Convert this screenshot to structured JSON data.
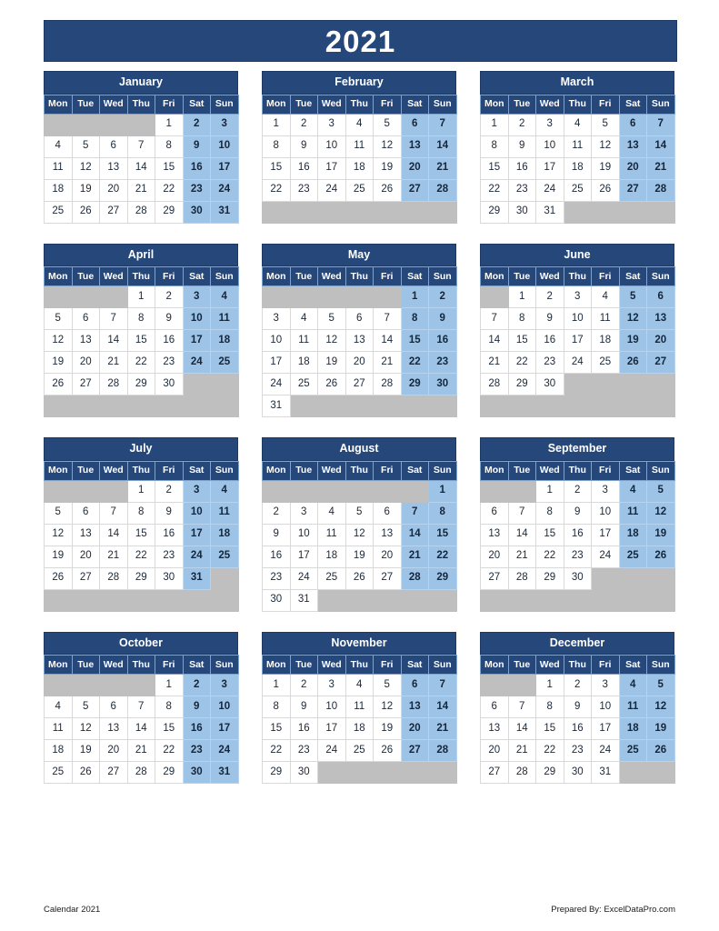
{
  "document": {
    "title": "2021",
    "footer_left": "Calendar 2021",
    "footer_right": "Prepared By: ExcelDataPro.com"
  },
  "colors": {
    "header_blue": "#26477a",
    "weekend_blue": "#9dc3e6",
    "filler_gray": "#bfbfbf",
    "weekday_white": "#ffffff",
    "text_dark": "#1b2838"
  },
  "weekday_headers": [
    "Mon",
    "Tue",
    "Wed",
    "Thu",
    "Fri",
    "Sat",
    "Sun"
  ],
  "months": [
    {
      "name": "January",
      "weeks": [
        [
          "",
          "",
          "",
          "",
          "1",
          "2",
          "3"
        ],
        [
          "4",
          "5",
          "6",
          "7",
          "8",
          "9",
          "10"
        ],
        [
          "11",
          "12",
          "13",
          "14",
          "15",
          "16",
          "17"
        ],
        [
          "18",
          "19",
          "20",
          "21",
          "22",
          "23",
          "24"
        ],
        [
          "25",
          "26",
          "27",
          "28",
          "29",
          "30",
          "31"
        ]
      ]
    },
    {
      "name": "February",
      "weeks": [
        [
          "1",
          "2",
          "3",
          "4",
          "5",
          "6",
          "7"
        ],
        [
          "8",
          "9",
          "10",
          "11",
          "12",
          "13",
          "14"
        ],
        [
          "15",
          "16",
          "17",
          "18",
          "19",
          "20",
          "21"
        ],
        [
          "22",
          "23",
          "24",
          "25",
          "26",
          "27",
          "28"
        ],
        [
          "",
          "",
          "",
          "",
          "",
          "",
          ""
        ]
      ]
    },
    {
      "name": "March",
      "weeks": [
        [
          "1",
          "2",
          "3",
          "4",
          "5",
          "6",
          "7"
        ],
        [
          "8",
          "9",
          "10",
          "11",
          "12",
          "13",
          "14"
        ],
        [
          "15",
          "16",
          "17",
          "18",
          "19",
          "20",
          "21"
        ],
        [
          "22",
          "23",
          "24",
          "25",
          "26",
          "27",
          "28"
        ],
        [
          "29",
          "30",
          "31",
          "",
          "",
          "",
          ""
        ]
      ]
    },
    {
      "name": "April",
      "weeks": [
        [
          "",
          "",
          "",
          "1",
          "2",
          "3",
          "4"
        ],
        [
          "5",
          "6",
          "7",
          "8",
          "9",
          "10",
          "11"
        ],
        [
          "12",
          "13",
          "14",
          "15",
          "16",
          "17",
          "18"
        ],
        [
          "19",
          "20",
          "21",
          "22",
          "23",
          "24",
          "25"
        ],
        [
          "26",
          "27",
          "28",
          "29",
          "30",
          "",
          ""
        ],
        [
          "",
          "",
          "",
          "",
          "",
          "",
          ""
        ]
      ]
    },
    {
      "name": "May",
      "weeks": [
        [
          "",
          "",
          "",
          "",
          "",
          "1",
          "2"
        ],
        [
          "3",
          "4",
          "5",
          "6",
          "7",
          "8",
          "9"
        ],
        [
          "10",
          "11",
          "12",
          "13",
          "14",
          "15",
          "16"
        ],
        [
          "17",
          "18",
          "19",
          "20",
          "21",
          "22",
          "23"
        ],
        [
          "24",
          "25",
          "26",
          "27",
          "28",
          "29",
          "30"
        ],
        [
          "31",
          "",
          "",
          "",
          "",
          "",
          ""
        ]
      ]
    },
    {
      "name": "June",
      "weeks": [
        [
          "",
          "1",
          "2",
          "3",
          "4",
          "5",
          "6"
        ],
        [
          "7",
          "8",
          "9",
          "10",
          "11",
          "12",
          "13"
        ],
        [
          "14",
          "15",
          "16",
          "17",
          "18",
          "19",
          "20"
        ],
        [
          "21",
          "22",
          "23",
          "24",
          "25",
          "26",
          "27"
        ],
        [
          "28",
          "29",
          "30",
          "",
          "",
          "",
          ""
        ],
        [
          "",
          "",
          "",
          "",
          "",
          "",
          ""
        ]
      ]
    },
    {
      "name": "July",
      "weeks": [
        [
          "",
          "",
          "",
          "1",
          "2",
          "3",
          "4"
        ],
        [
          "5",
          "6",
          "7",
          "8",
          "9",
          "10",
          "11"
        ],
        [
          "12",
          "13",
          "14",
          "15",
          "16",
          "17",
          "18"
        ],
        [
          "19",
          "20",
          "21",
          "22",
          "23",
          "24",
          "25"
        ],
        [
          "26",
          "27",
          "28",
          "29",
          "30",
          "31",
          ""
        ],
        [
          "",
          "",
          "",
          "",
          "",
          "",
          ""
        ]
      ]
    },
    {
      "name": "August",
      "weeks": [
        [
          "",
          "",
          "",
          "",
          "",
          "",
          "1"
        ],
        [
          "2",
          "3",
          "4",
          "5",
          "6",
          "7",
          "8"
        ],
        [
          "9",
          "10",
          "11",
          "12",
          "13",
          "14",
          "15"
        ],
        [
          "16",
          "17",
          "18",
          "19",
          "20",
          "21",
          "22"
        ],
        [
          "23",
          "24",
          "25",
          "26",
          "27",
          "28",
          "29"
        ],
        [
          "30",
          "31",
          "",
          "",
          "",
          "",
          ""
        ]
      ]
    },
    {
      "name": "September",
      "weeks": [
        [
          "",
          "",
          "1",
          "2",
          "3",
          "4",
          "5"
        ],
        [
          "6",
          "7",
          "8",
          "9",
          "10",
          "11",
          "12"
        ],
        [
          "13",
          "14",
          "15",
          "16",
          "17",
          "18",
          "19"
        ],
        [
          "20",
          "21",
          "22",
          "23",
          "24",
          "25",
          "26"
        ],
        [
          "27",
          "28",
          "29",
          "30",
          "",
          "",
          ""
        ],
        [
          "",
          "",
          "",
          "",
          "",
          "",
          ""
        ]
      ]
    },
    {
      "name": "October",
      "weeks": [
        [
          "",
          "",
          "",
          "",
          "1",
          "2",
          "3"
        ],
        [
          "4",
          "5",
          "6",
          "7",
          "8",
          "9",
          "10"
        ],
        [
          "11",
          "12",
          "13",
          "14",
          "15",
          "16",
          "17"
        ],
        [
          "18",
          "19",
          "20",
          "21",
          "22",
          "23",
          "24"
        ],
        [
          "25",
          "26",
          "27",
          "28",
          "29",
          "30",
          "31"
        ]
      ]
    },
    {
      "name": "November",
      "weeks": [
        [
          "1",
          "2",
          "3",
          "4",
          "5",
          "6",
          "7"
        ],
        [
          "8",
          "9",
          "10",
          "11",
          "12",
          "13",
          "14"
        ],
        [
          "15",
          "16",
          "17",
          "18",
          "19",
          "20",
          "21"
        ],
        [
          "22",
          "23",
          "24",
          "25",
          "26",
          "27",
          "28"
        ],
        [
          "29",
          "30",
          "",
          "",
          "",
          "",
          ""
        ]
      ]
    },
    {
      "name": "December",
      "weeks": [
        [
          "",
          "",
          "1",
          "2",
          "3",
          "4",
          "5"
        ],
        [
          "6",
          "7",
          "8",
          "9",
          "10",
          "11",
          "12"
        ],
        [
          "13",
          "14",
          "15",
          "16",
          "17",
          "18",
          "19"
        ],
        [
          "20",
          "21",
          "22",
          "23",
          "24",
          "25",
          "26"
        ],
        [
          "27",
          "28",
          "29",
          "30",
          "31",
          "",
          ""
        ]
      ]
    }
  ]
}
